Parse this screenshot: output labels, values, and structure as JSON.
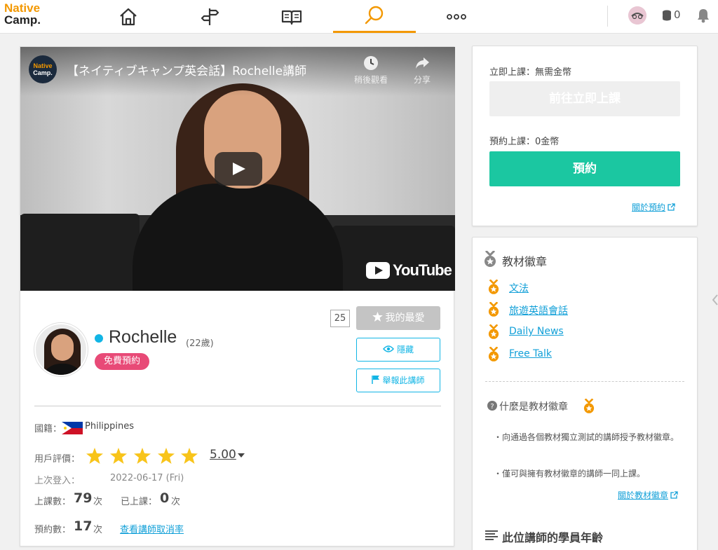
{
  "nav": {
    "logo_line1": "Native",
    "logo_line2": "Camp.",
    "tabs": [
      {
        "icon": "home-icon"
      },
      {
        "icon": "signpost-icon"
      },
      {
        "icon": "book-icon"
      },
      {
        "icon": "search-icon",
        "active": true
      },
      {
        "icon": "more-icon"
      }
    ],
    "coin_count": "0",
    "accent": "#f39800"
  },
  "video": {
    "channel_line1": "Native",
    "channel_line2": "Camp.",
    "title": "【ネイティブキャンプ英会話】Rochelle講師",
    "watch_later": "稍後觀看",
    "share": "分享",
    "brand": "YouTube"
  },
  "teacher": {
    "name": "Rochelle",
    "age": "(22歲)",
    "free_badge": "免費預約",
    "fav_count": "25",
    "fav_label": "我的最愛",
    "hide_label": "隱藏",
    "report_label": "舉報此講師",
    "nationality_label": "國籍：",
    "nationality": "Philippines",
    "rating_label": "用戶評價：",
    "rating": "5.00",
    "rating_stars": 5,
    "last_login_label": "上次登入：",
    "last_login": "2022-06-17 (Fri)",
    "lessons_label": "上課數：",
    "lessons": "79",
    "lessons_unit": "次",
    "taken_label": "已上課：",
    "taken": "0",
    "taken_unit": "次",
    "bookings_label": "預約數：",
    "bookings": "17",
    "bookings_unit": "次",
    "cancel_link": "查看講師取消率"
  },
  "booking": {
    "instant_label": "立即上課：無需金幣",
    "instant_button": "前往立即上課",
    "reserve_label": "預約上課：0金幣",
    "reserve_button": "預約",
    "about_link": "關於預約",
    "button_color": "#1bc7a1"
  },
  "badges": {
    "title": "教材徽章",
    "items": [
      "文法",
      "旅遊英語會話",
      "Daily News",
      "Free Talk"
    ],
    "what_title": "什麼是教材徽章",
    "notes": [
      "・向通過各個教材獨立測試的講師授予教材徽章。",
      "・僅可與擁有教材徽章的講師一同上課。"
    ],
    "about_link": "關於教材徽章",
    "students_title": "此位講師的學員年齡"
  }
}
